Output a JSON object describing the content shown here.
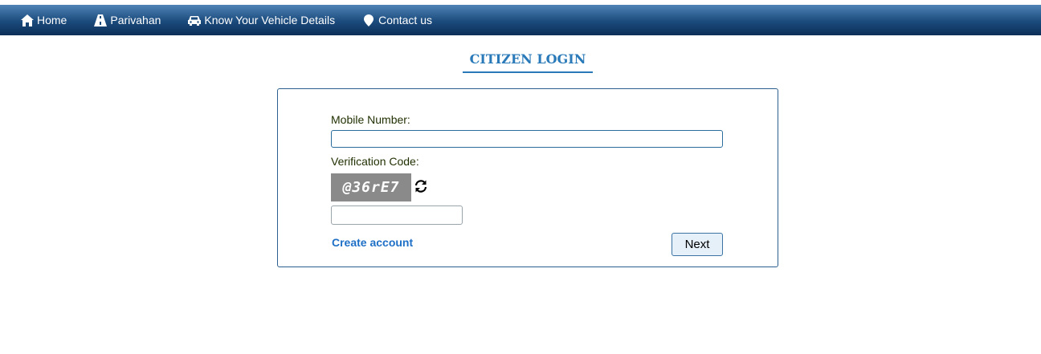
{
  "nav": {
    "items": [
      {
        "label": "Home",
        "icon": "home-icon"
      },
      {
        "label": "Parivahan",
        "icon": "road-icon"
      },
      {
        "label": "Know Your Vehicle Details",
        "icon": "car-icon"
      },
      {
        "label": "Contact us",
        "icon": "map-marker-icon"
      }
    ]
  },
  "page": {
    "title": "CITIZEN LOGIN"
  },
  "form": {
    "mobile_label": "Mobile Number:",
    "mobile_value": "",
    "verification_label": "Verification Code:",
    "captcha_text": "@36rE7",
    "captcha_value": "",
    "create_account": "Create account",
    "next_label": "Next"
  },
  "colors": {
    "navbar": "#1b4a7c",
    "title": "#2a7ab9",
    "link": "#1e70c6"
  }
}
